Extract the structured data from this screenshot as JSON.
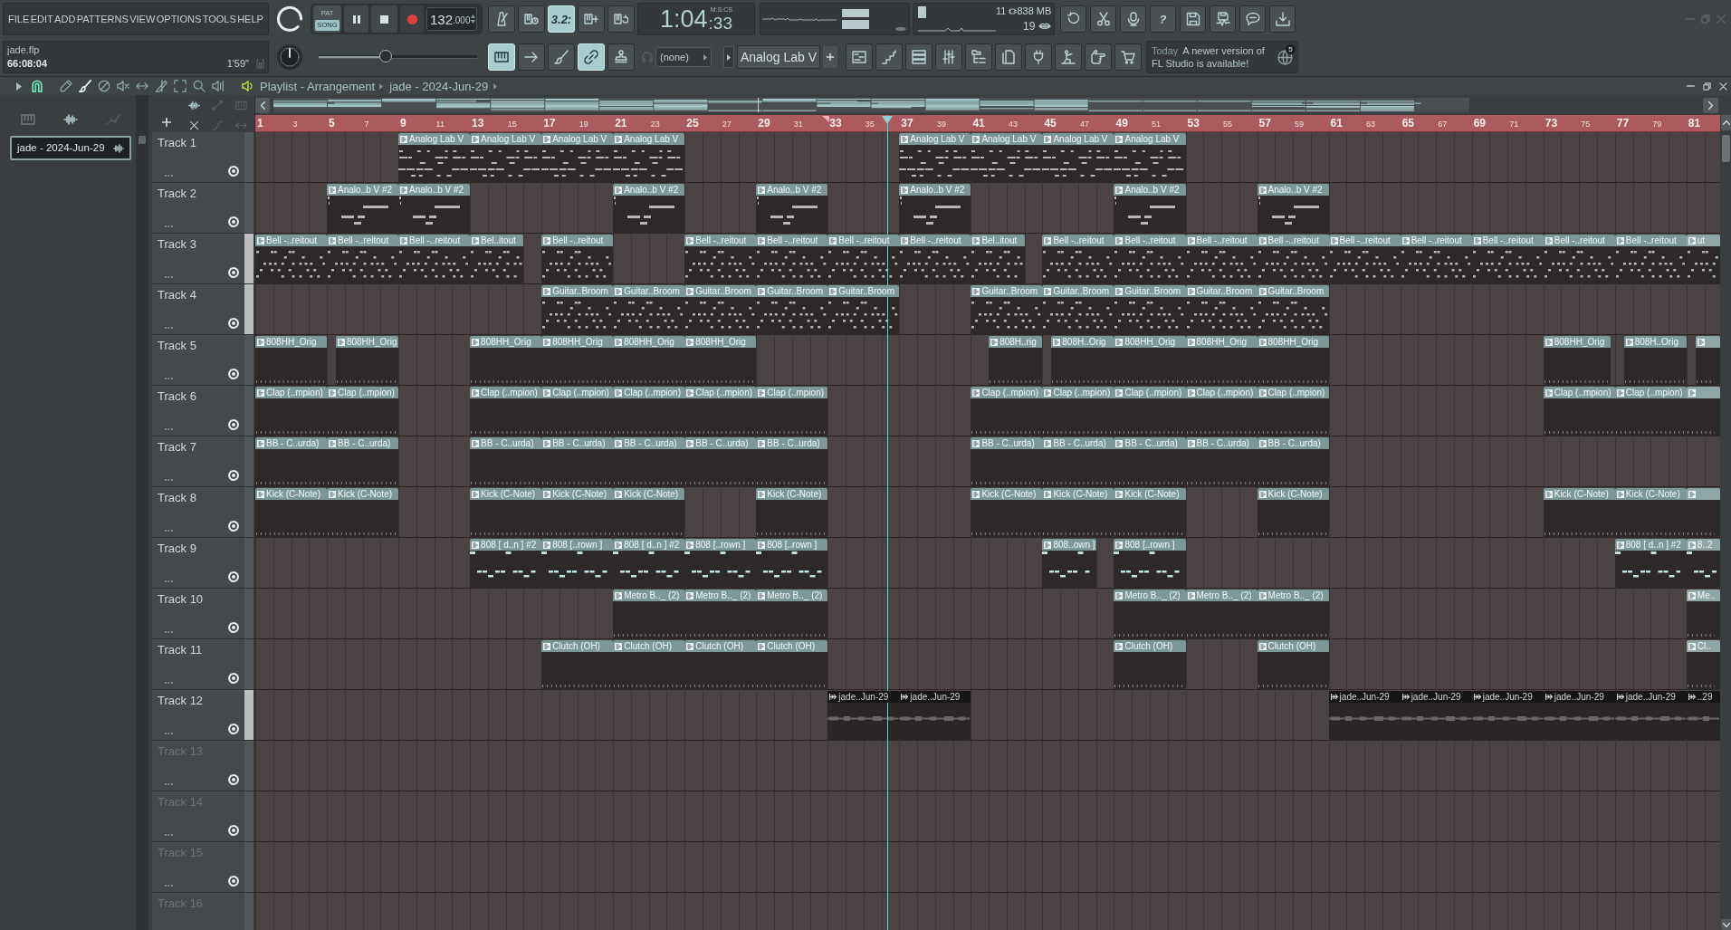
{
  "menu": [
    "FILE",
    "EDIT",
    "ADD",
    "PATTERNS",
    "VIEW",
    "OPTIONS",
    "TOOLS",
    "HELP"
  ],
  "transport": {
    "pat_song": [
      {
        "label": "PAT",
        "selected": false
      },
      {
        "label": "SONG",
        "selected": true
      }
    ],
    "playing": true,
    "tempo": "132",
    "tempo_decimals": ".000"
  },
  "record_buttons": [
    {
      "kind": "metronome",
      "on": false
    },
    {
      "kind": "wait",
      "on": false
    },
    {
      "kind": "countdown",
      "label": "3.2:",
      "on": true
    },
    {
      "kind": "step",
      "on": false
    },
    {
      "kind": "loop",
      "on": false
    }
  ],
  "time": {
    "main": "1:04",
    "centiseconds": ":33",
    "format": "M:S:CS"
  },
  "system": {
    "cpu": "11",
    "memory": "838 MB",
    "polyphony": "19"
  },
  "help_label": "?",
  "file": {
    "name": "jade.flp",
    "time": "66:08:04",
    "length": "1'59\""
  },
  "pitch_slider": {
    "level": 0.42
  },
  "tool_buttons": [
    {
      "kind": "piano-roll",
      "on": true
    },
    {
      "kind": "arrow",
      "on": false
    },
    {
      "kind": "brush",
      "on": false
    },
    {
      "kind": "link",
      "on": true
    },
    {
      "kind": "stamp",
      "on": false
    }
  ],
  "pattern_selector": {
    "value": "(none)"
  },
  "channel_selector": {
    "value": "Analog Lab V"
  },
  "news": {
    "date": "Today",
    "lines": [
      "A newer version of",
      "FL Studio is available!"
    ],
    "badge": "5"
  },
  "playlist": {
    "title": "Playlist - Arrangement",
    "arrangement": "jade - 2024-Jun-29",
    "snap": {
      "on": true
    },
    "tools": [
      {
        "kind": "pencil",
        "selected": false
      },
      {
        "kind": "paint",
        "selected": true
      },
      {
        "kind": "delete",
        "selected": false
      },
      {
        "kind": "mute",
        "selected": false
      },
      {
        "kind": "slip",
        "selected": false
      },
      {
        "kind": "slice",
        "selected": false
      },
      {
        "kind": "select",
        "selected": false
      },
      {
        "kind": "zoom",
        "selected": false
      },
      {
        "kind": "playback",
        "selected": false
      }
    ],
    "picker": [
      {
        "label": "jade - 2024-Jun-29",
        "selected": true
      }
    ],
    "ruler": [
      "1",
      "3",
      "5",
      "7",
      "9",
      "11",
      "13",
      "15",
      "17",
      "19",
      "21",
      "23",
      "25",
      "27",
      "29",
      "31",
      "33",
      "35",
      "37",
      "39",
      "41",
      "43",
      "45",
      "47",
      "49",
      "51",
      "53",
      "55",
      "57",
      "59",
      "61",
      "63",
      "65",
      "67",
      "69",
      "71",
      "73",
      "75",
      "77",
      "79",
      "81"
    ],
    "song_position": {
      "level": 0.4315
    },
    "tracks": [
      {
        "name": "Track 1",
        "selected": false,
        "on": true,
        "clips": [
          {
            "label": "Analog Lab V",
            "kind": "pattern"
          },
          {
            "label": "Analog Lab V",
            "kind": "pattern"
          },
          {
            "label": "Analog Lab V",
            "kind": "pattern"
          },
          {
            "label": "Analog Lab V",
            "kind": "pattern"
          },
          {
            "label": "Analog Lab V",
            "kind": "pattern"
          },
          {
            "label": "Analog Lab V",
            "kind": "pattern"
          },
          {
            "label": "Analog Lab V",
            "kind": "pattern"
          },
          {
            "label": "Analog Lab V",
            "kind": "pattern"
          }
        ]
      },
      {
        "name": "Track 2",
        "selected": false,
        "on": true,
        "clips": [
          {
            "label": "Analo..b V #2",
            "kind": "pattern"
          },
          {
            "label": "Analo..b V #2",
            "kind": "pattern"
          },
          {
            "label": "Analo..b V #2",
            "kind": "pattern"
          },
          {
            "label": "Analo..b V #2",
            "kind": "pattern"
          },
          {
            "label": "Analo..b V #2",
            "kind": "pattern"
          },
          {
            "label": "Analo..b V #2",
            "kind": "pattern"
          },
          {
            "label": "Analo..b V #2",
            "kind": "pattern"
          }
        ]
      },
      {
        "name": "Track 3",
        "selected": true,
        "on": true,
        "clips": [
          {
            "label": "Bell -..reitout",
            "kind": "pattern"
          },
          {
            "label": "Bell -..reitout",
            "kind": "pattern"
          },
          {
            "label": "Bell -..reitout",
            "kind": "pattern"
          },
          {
            "label": "Bel..itout",
            "kind": "pattern"
          },
          {
            "label": "Bell -..reitout",
            "kind": "pattern"
          },
          {
            "label": "Bell -..reitout",
            "kind": "pattern"
          },
          {
            "label": "Bell -..reitout",
            "kind": "pattern"
          },
          {
            "label": "Bell -..reitout",
            "kind": "pattern"
          },
          {
            "label": "Bell -..reitout",
            "kind": "pattern"
          },
          {
            "label": "Bel..itout",
            "kind": "pattern"
          },
          {
            "label": "Bell -..reitout",
            "kind": "pattern"
          },
          {
            "label": "Bell -..reitout",
            "kind": "pattern"
          },
          {
            "label": "Bell -..reitout",
            "kind": "pattern"
          },
          {
            "label": "Bell -..reitout",
            "kind": "pattern"
          },
          {
            "label": "Bell -..reitout",
            "kind": "pattern"
          },
          {
            "label": "Bell -..reitout",
            "kind": "pattern"
          },
          {
            "label": "Bell -..reitout",
            "kind": "pattern"
          },
          {
            "label": "Bell -..reitout",
            "kind": "pattern"
          },
          {
            "label": "Bell -..reitout",
            "kind": "pattern"
          },
          {
            "label": "ut",
            "kind": "pattern"
          }
        ]
      },
      {
        "name": "Track 4",
        "selected": true,
        "on": true,
        "clips": [
          {
            "label": "Guitar..Broom",
            "kind": "pattern"
          },
          {
            "label": "Guitar..Broom",
            "kind": "pattern"
          },
          {
            "label": "Guitar..Broom",
            "kind": "pattern"
          },
          {
            "label": "Guitar..Broom",
            "kind": "pattern"
          },
          {
            "label": "Guitar..Broom",
            "kind": "pattern"
          },
          {
            "label": "Guitar..Broom",
            "kind": "pattern"
          },
          {
            "label": "Guitar..Broom",
            "kind": "pattern"
          },
          {
            "label": "Guitar..Broom",
            "kind": "pattern"
          },
          {
            "label": "Guitar..Broom",
            "kind": "pattern"
          },
          {
            "label": "Guitar..Broom",
            "kind": "pattern"
          }
        ]
      },
      {
        "name": "Track 5",
        "selected": false,
        "on": true,
        "clips": [
          {
            "label": "808HH_Orig",
            "kind": "pattern"
          },
          {
            "label": "808HH_Orig",
            "kind": "pattern"
          },
          {
            "label": "808HH_Orig",
            "kind": "pattern"
          },
          {
            "label": "808HH_Orig",
            "kind": "pattern"
          },
          {
            "label": "808HH_Orig",
            "kind": "pattern"
          },
          {
            "label": "808HH_Orig",
            "kind": "pattern"
          },
          {
            "label": "808H..rig",
            "kind": "pattern"
          },
          {
            "label": "808H..Orig",
            "kind": "pattern"
          },
          {
            "label": "808HH_Orig",
            "kind": "pattern"
          },
          {
            "label": "808HH_Orig",
            "kind": "pattern"
          },
          {
            "label": "808HH_Orig",
            "kind": "pattern"
          },
          {
            "label": "808HH_Orig",
            "kind": "pattern"
          },
          {
            "label": "808H..Orig",
            "kind": "pattern"
          },
          {
            "kind": "pattern"
          }
        ]
      },
      {
        "name": "Track 6",
        "selected": false,
        "on": true,
        "clips": [
          {
            "label": "Clap (..mpion)",
            "kind": "pattern"
          },
          {
            "label": "Clap (..mpion)",
            "kind": "pattern"
          },
          {
            "label": "Clap (..mpion)",
            "kind": "pattern"
          },
          {
            "label": "Clap (..mpion)",
            "kind": "pattern"
          },
          {
            "label": "Clap (..mpion)",
            "kind": "pattern"
          },
          {
            "label": "Clap (..mpion)",
            "kind": "pattern"
          },
          {
            "label": "Clap (..mpion)",
            "kind": "pattern"
          },
          {
            "label": "Clap (..mpion)",
            "kind": "pattern"
          },
          {
            "label": "Clap (..mpion)",
            "kind": "pattern"
          },
          {
            "label": "Clap (..mpion)",
            "kind": "pattern"
          },
          {
            "label": "Clap (..mpion)",
            "kind": "pattern"
          },
          {
            "label": "Clap (..mpion)",
            "kind": "pattern"
          },
          {
            "label": "Clap (..mpion)",
            "kind": "pattern"
          },
          {
            "label": "Clap (..mpion)",
            "kind": "pattern"
          },
          {
            "kind": "pattern"
          }
        ]
      },
      {
        "name": "Track 7",
        "selected": false,
        "on": true,
        "clips": [
          {
            "label": "BB - C..urda)",
            "kind": "pattern"
          },
          {
            "label": "BB - C..urda)",
            "kind": "pattern"
          },
          {
            "label": "BB - C..urda)",
            "kind": "pattern"
          },
          {
            "label": "BB - C..urda)",
            "kind": "pattern"
          },
          {
            "label": "BB - C..urda)",
            "kind": "pattern"
          },
          {
            "label": "BB - C..urda)",
            "kind": "pattern"
          },
          {
            "label": "BB - C..urda)",
            "kind": "pattern"
          },
          {
            "label": "BB - C..urda)",
            "kind": "pattern"
          },
          {
            "label": "BB - C..urda)",
            "kind": "pattern"
          },
          {
            "label": "BB - C..urda)",
            "kind": "pattern"
          },
          {
            "label": "BB - C..urda)",
            "kind": "pattern"
          },
          {
            "label": "BB - C..urda)",
            "kind": "pattern"
          }
        ]
      },
      {
        "name": "Track 8",
        "selected": false,
        "on": true,
        "clips": [
          {
            "label": "Kick (C-Note)",
            "kind": "pattern"
          },
          {
            "label": "Kick (C-Note)",
            "kind": "pattern"
          },
          {
            "label": "Kick (C-Note)",
            "kind": "pattern"
          },
          {
            "label": "Kick (C-Note)",
            "kind": "pattern"
          },
          {
            "label": "Kick (C-Note)",
            "kind": "pattern"
          },
          {
            "label": "Kick (C-Note)",
            "kind": "pattern"
          },
          {
            "label": "Kick (C-Note)",
            "kind": "pattern"
          },
          {
            "label": "Kick (C-Note)",
            "kind": "pattern"
          },
          {
            "label": "Kick (C-Note)",
            "kind": "pattern"
          },
          {
            "label": "Kick (C-Note)",
            "kind": "pattern"
          },
          {
            "label": "Kick (C-Note)",
            "kind": "pattern"
          },
          {
            "label": "Kick (C-Note)",
            "kind": "pattern"
          },
          {
            "kind": "pattern"
          }
        ]
      },
      {
        "name": "Track 9",
        "selected": false,
        "on": true,
        "clips": [
          {
            "label": "808 [ d..n ] #2",
            "kind": "pattern"
          },
          {
            "label": "808 [..rown ]",
            "kind": "pattern"
          },
          {
            "label": "808 [ d..n ] #2",
            "kind": "pattern"
          },
          {
            "label": "808 [..rown ]",
            "kind": "pattern"
          },
          {
            "label": "808 [..rown ]",
            "kind": "pattern"
          },
          {
            "label": "808..own ]",
            "kind": "pattern"
          },
          {
            "label": "808 [..rown ]",
            "kind": "pattern"
          },
          {
            "label": "808 [ d..n ] #2",
            "kind": "pattern"
          },
          {
            "label": "8..2",
            "kind": "pattern"
          }
        ]
      },
      {
        "name": "Track 10",
        "selected": false,
        "on": true,
        "clips": [
          {
            "label": "Metro B.._ (2)",
            "kind": "pattern"
          },
          {
            "label": "Metro B.._ (2)",
            "kind": "pattern"
          },
          {
            "label": "Metro B.._ (2)",
            "kind": "pattern"
          },
          {
            "label": "Metro B.._ (2)",
            "kind": "pattern"
          },
          {
            "label": "Metro B.._ (2)",
            "kind": "pattern"
          },
          {
            "label": "Metro B.._ (2)",
            "kind": "pattern"
          },
          {
            "label": "Me..",
            "kind": "pattern"
          }
        ]
      },
      {
        "name": "Track 11",
        "selected": false,
        "on": true,
        "clips": [
          {
            "label": "Clutch (OH)",
            "kind": "pattern"
          },
          {
            "label": "Clutch (OH)",
            "kind": "pattern"
          },
          {
            "label": "Clutch (OH)",
            "kind": "pattern"
          },
          {
            "label": "Clutch (OH)",
            "kind": "pattern"
          },
          {
            "label": "Clutch (OH)",
            "kind": "pattern"
          },
          {
            "label": "Clutch (OH)",
            "kind": "pattern"
          },
          {
            "label": "Cl..",
            "kind": "pattern"
          }
        ]
      },
      {
        "name": "Track 12",
        "selected": true,
        "on": true,
        "clips": [
          {
            "label": "jade..Jun-29",
            "kind": "audio"
          },
          {
            "label": "jade..Jun-29",
            "kind": "audio"
          },
          {
            "label": "jade..Jun-29",
            "kind": "audio"
          },
          {
            "label": "jade..Jun-29",
            "kind": "audio"
          },
          {
            "label": "jade..Jun-29",
            "kind": "audio"
          },
          {
            "label": "jade..Jun-29",
            "kind": "audio"
          },
          {
            "label": "jade..Jun-29",
            "kind": "audio"
          },
          {
            "label": "..29",
            "kind": "audio"
          }
        ]
      },
      {
        "name": "Track 13",
        "selected": false,
        "on": true
      },
      {
        "name": "Track 14",
        "selected": false,
        "on": true
      },
      {
        "name": "Track 15",
        "selected": false,
        "on": true
      },
      {
        "name": "Track 16",
        "selected": false
      }
    ]
  }
}
